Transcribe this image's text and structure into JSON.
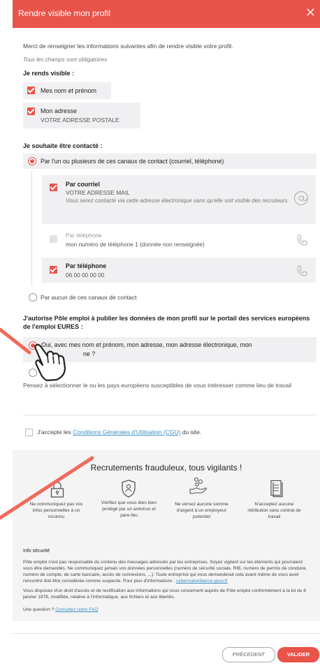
{
  "modal": {
    "title": "Rendre visible mon profil",
    "intro": "Merci de renseigner les informations suivantes afin de rendre visible votre profil.",
    "required_note": "Tous les champs sont obligatoires"
  },
  "visible_section": {
    "heading": "Je rends visible :",
    "name_label": "Mes nom et prénom",
    "address_label": "Mon adresse",
    "address_value": "VOTRE ADRESSE POSTALE"
  },
  "contact_section": {
    "heading": "Je souhaite être contacté :",
    "option_channels": "Par l'un ou plusieurs de ces canaux de contact (courriel, téléphone)",
    "email_label": "Par courriel",
    "email_value": "VOTRE ADRESSE MAIL",
    "email_note": "Vous serez contacté via cette adresse électronique sans qu'elle soit visible des recruteurs.",
    "phone1_label": "Par téléphone",
    "phone1_value": "mon numéro de téléphone 1 (donnée non renseignée)",
    "phone2_label": "Par téléphone",
    "phone2_value": "06 00 00 00 00",
    "option_none": "Par aucun de ces canaux de contact"
  },
  "eures_section": {
    "heading": "J'autorise Pôle emploi à publier les données de mon profil sur le portail des services européens de l'emploi EURES :",
    "option_yes_a": "Oui, avec mes nom et prénom, mon adresse, mon adresse électronique, mon",
    "option_yes_b": "ne ?",
    "hint": "Pensez à sélectionner le ou les pays européens susceptibles de vous intéresser comme lieu de travail"
  },
  "cgu": {
    "prefix": "J'accepte les ",
    "link": "Conditions Générales d'Utilisation (CGU)",
    "suffix": " du site."
  },
  "fraud": {
    "title": "Recrutements frauduleux, tous vigilants !",
    "items": [
      {
        "icon": "padlock-icon",
        "text": "Ne communiquez pas vos infos personnelles à un inconnu"
      },
      {
        "icon": "shield-user-icon",
        "text": "Vérifiez que vous êtes bien protégé par un antivirus et pare-feu"
      },
      {
        "icon": "hand-coins-icon",
        "text": "Ne versez aucune somme d'argent à un employeur potentiel"
      },
      {
        "icon": "document-icon",
        "text": "N'acceptez aucune rétribution sans contrat de travail"
      }
    ],
    "info_heading": "Info sécurité",
    "info_text": "Pôle emploi n'est pas responsable du contenu des messages adressés par les entreprises. Soyez vigilant sur les éléments qui pourraient vous être demandés. Ne communiquez jamais vos données personnelles (numéro de sécurité sociale, RIB, numéro de permis de conduire, numéro de compte, de carte bancaire, accès de connexions, ...). Toute entreprise qui vous demanderait cela avant même de vous avoir rencontré doit être considérée comme suspecte. Pour plus d'informations : ",
    "info_link": "cybermalveillance.gouv.fr",
    "rights_text": "Vous disposez d'un droit d'accès et de rectification aux informations qui vous concernent auprès de Pôle emploi conformément à la loi du 6 janvier 1978, modifiée, relative à l'informatique, aux fichiers et aux libertés.",
    "question_prefix": "Une question ? ",
    "question_link": "Consultez notre FAQ"
  },
  "buttons": {
    "prev": "PRÉCÉDENT",
    "ok": "VALIDER"
  },
  "colors": {
    "accent": "#e8534a",
    "annotation_arrow": "#f06a5c",
    "link": "#3a8fc4"
  }
}
